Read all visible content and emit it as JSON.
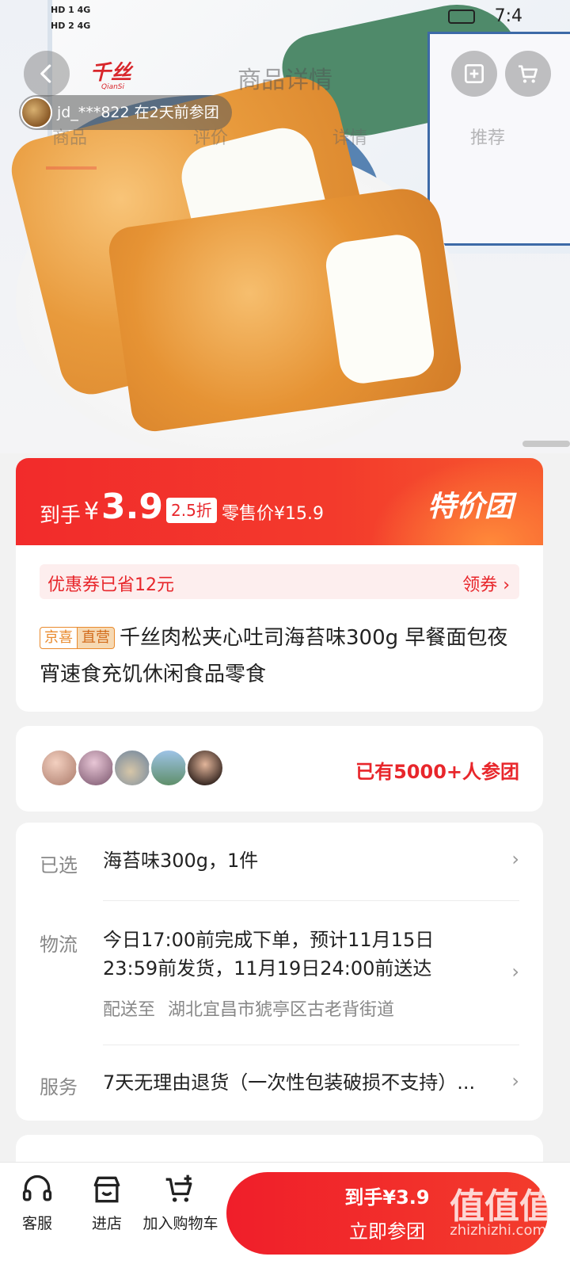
{
  "status_bar": {
    "network_1": "HD 1 4G",
    "network_2": "HD 2 4G",
    "time": "7:4"
  },
  "header": {
    "title": "商品详情",
    "brand_logo_text": "千丝"
  },
  "tabs": [
    "商品",
    "评价",
    "详情",
    "推荐"
  ],
  "join_notice": "jd_***822 在2天前参团",
  "price": {
    "prefix": "到手",
    "currency": "¥",
    "amount": "3.9",
    "discount": "2.5折",
    "retail": "零售价¥15.9",
    "badge": "特价团"
  },
  "coupon": {
    "text": "优惠券已省12元",
    "action": "领券 ›"
  },
  "product": {
    "tag_1": "京喜",
    "tag_2": "直营",
    "title": "千丝肉松夹心吐司海苔味300g 早餐面包夜宵速食充饥休闲食品零食"
  },
  "group": {
    "count_text": "已有5000+人参团"
  },
  "info": {
    "selected_label": "已选",
    "selected_value": "海苔味300g，1件",
    "logistics_label": "物流",
    "logistics_value_1": "今日17:00前完成下单，预计11月15日",
    "logistics_value_2": "23:59前发货，11月19日24:00前送达",
    "ship_to_label": "配送至",
    "ship_to_value": "湖北宜昌市猇亭区古老背街道",
    "service_label": "服务",
    "service_value": "7天无理由退货（一次性包装破损不支持）..."
  },
  "bottom_bar": {
    "service_label": "客服",
    "shop_label": "进店",
    "cart_label": "加入购物车",
    "cta_price": "到手¥3.9",
    "cta_label": "立即参团"
  },
  "watermark": {
    "main": "值值值",
    "sub": "zhizhizhi.com"
  },
  "colors": {
    "accent": "#f22b2b",
    "coupon_bg": "#fdeeee",
    "tag_orange": "#e98a2d"
  }
}
